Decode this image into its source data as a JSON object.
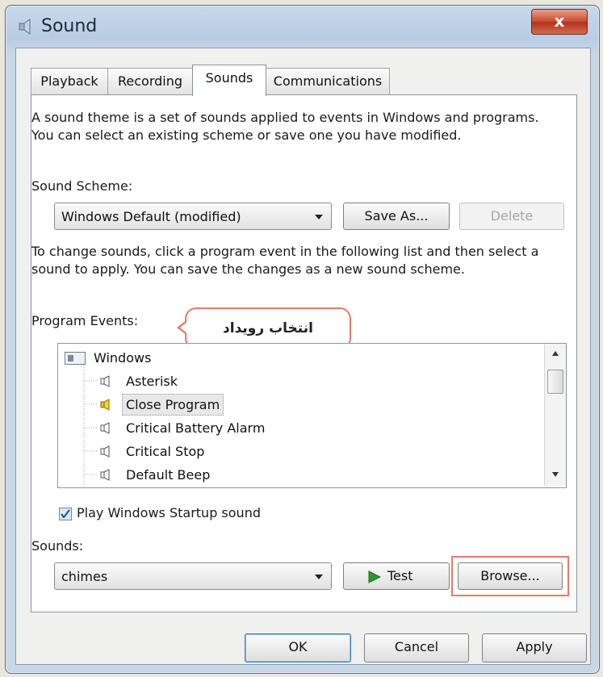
{
  "window": {
    "title": "Sound",
    "close_label": "x"
  },
  "tabs": [
    {
      "label": "Playback",
      "active": false
    },
    {
      "label": "Recording",
      "active": false
    },
    {
      "label": "Sounds",
      "active": true
    },
    {
      "label": "Communications",
      "active": false
    }
  ],
  "sounds_tab": {
    "intro": "A sound theme is a set of sounds applied to events in Windows and programs.  You can select an existing scheme or save one you have modified.",
    "scheme_label": "Sound Scheme:",
    "scheme_value": "Windows Default (modified)",
    "save_as_label": "Save As...",
    "delete_label": "Delete",
    "instructions": "To change sounds, click a program event in the following list and then select a sound to apply.  You can save the changes as a new sound scheme.",
    "events_label": "Program Events:",
    "annotation": "انتخاب رویداد",
    "events": [
      {
        "label": "Windows",
        "icon": "windows-folder-icon"
      },
      {
        "label": "Asterisk",
        "icon": "speaker-icon"
      },
      {
        "label": "Close Program",
        "icon": "speaker-icon",
        "selected": true
      },
      {
        "label": "Critical Battery Alarm",
        "icon": "speaker-icon"
      },
      {
        "label": "Critical Stop",
        "icon": "speaker-icon"
      },
      {
        "label": "Default Beep",
        "icon": "speaker-icon"
      }
    ],
    "startup_label": "Play Windows Startup sound",
    "startup_checked": true,
    "sounds_label": "Sounds:",
    "sound_value": "chimes",
    "test_label": "Test",
    "browse_label": "Browse..."
  },
  "footer": {
    "ok_label": "OK",
    "cancel_label": "Cancel",
    "apply_label": "Apply"
  },
  "colors": {
    "accent_outline": "#e07d6c",
    "titlebar": "#b8cde4",
    "close": "#c8482f"
  }
}
